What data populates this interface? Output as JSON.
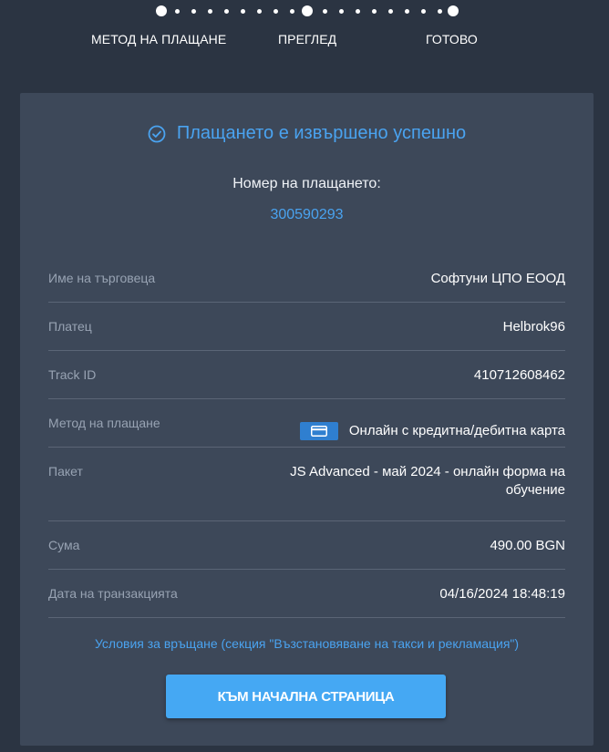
{
  "stepper": {
    "steps": [
      "МЕТОД НА ПЛАЩАНЕ",
      "ПРЕГЛЕД",
      "ГОТОВО"
    ],
    "current_step": 3
  },
  "confirmation": {
    "title": "Плащането е извършено успешно",
    "payment_number_label": "Номер на плащането:",
    "payment_number": "300590293"
  },
  "details": [
    {
      "label": "Име на търговеца",
      "value": "Софтуни ЦПО ЕООД"
    },
    {
      "label": "Платец",
      "value": "Helbrok96"
    },
    {
      "label": "Track ID",
      "value": "410712608462"
    },
    {
      "label": "Метод на плащане",
      "value": "Онлайн с кредитна/дебитна карта",
      "icon": "credit-card-icon"
    },
    {
      "label": "Пакет",
      "value": "JS Advanced - май 2024 - онлайн форма на обучение"
    },
    {
      "label": "Сума",
      "value": "490.00 BGN"
    },
    {
      "label": "Дата на транзакцията",
      "value": "04/16/2024 18:48:19"
    }
  ],
  "refund_link": "Условия за връщане (секция \"Възстановяване на такси и рекламация\")",
  "home_button": "КЪМ НАЧАЛНА СТРАНИЦА",
  "colors": {
    "background": "#2b3442",
    "card": "#3d4859",
    "accent": "#4aa3f0",
    "button": "#45a8f3"
  }
}
